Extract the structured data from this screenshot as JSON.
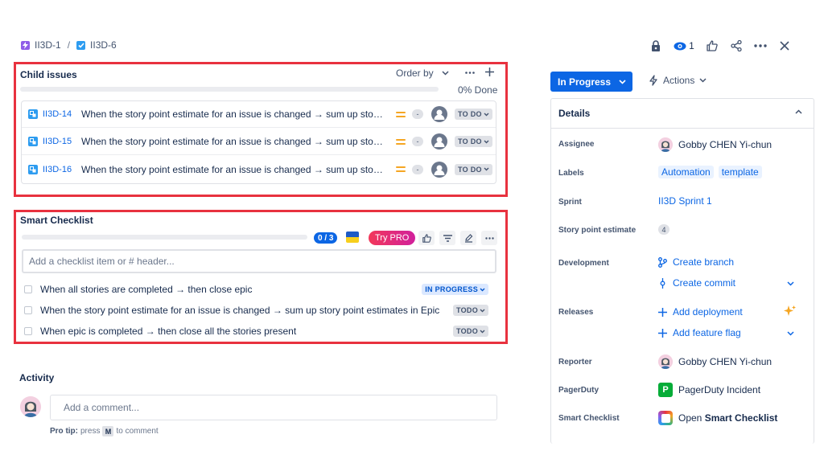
{
  "breadcrumb": {
    "parent_key": "II3D-1",
    "separator": "/",
    "current_key": "II3D-6"
  },
  "toolbar": {
    "watch_count": "1",
    "icons": [
      "lock-icon",
      "eye-icon",
      "thumbs-up-icon",
      "share-icon",
      "more-icon",
      "close-icon"
    ]
  },
  "child_issues": {
    "title": "Child issues",
    "order_by_label": "Order by",
    "progress_label": "0% Done",
    "progress_fraction": 0,
    "items": [
      {
        "key": "II3D-14",
        "summary": "When the story point estimate for an issue is changed → sum up story points estimates in Epic",
        "estimate": "-",
        "status": "TO DO"
      },
      {
        "key": "II3D-15",
        "summary": "When the story point estimate for an issue is changed → sum up story points estimates in Epic",
        "estimate": "-",
        "status": "TO DO"
      },
      {
        "key": "II3D-16",
        "summary": "When the story point estimate for an issue is changed → sum up story points estimates in Epic",
        "estimate": "-",
        "status": "TO DO"
      }
    ]
  },
  "smart_checklist": {
    "title": "Smart Checklist",
    "count": "0 / 3",
    "progress_fraction": 0,
    "try_pro_label": "Try PRO",
    "input_placeholder": "Add a checklist item or # header...",
    "items": [
      {
        "text": "When all stories are completed → then close epic",
        "status": "IN PROGRESS"
      },
      {
        "text": "When the story point estimate for an issue is changed → sum up story point estimates in Epic",
        "status": "TODO"
      },
      {
        "text": "When epic is completed → then close all the stories present",
        "status": "TODO"
      }
    ]
  },
  "activity": {
    "title": "Activity",
    "comment_placeholder": "Add a comment...",
    "pro_tip_label": "Pro tip:",
    "pro_tip_press": "press",
    "pro_tip_key": "M",
    "pro_tip_suffix": "to comment"
  },
  "status_button": {
    "label": "In Progress"
  },
  "actions_button": {
    "label": "Actions"
  },
  "details": {
    "title": "Details",
    "assignee_label": "Assignee",
    "assignee": "Gobby CHEN Yi-chun",
    "labels_label": "Labels",
    "labels": [
      "Automation",
      "template"
    ],
    "sprint_label": "Sprint",
    "sprint": "II3D Sprint 1",
    "story_points_label": "Story point estimate",
    "story_points": "4",
    "development_label": "Development",
    "create_branch": "Create branch",
    "create_commit": "Create commit",
    "releases_label": "Releases",
    "add_deployment": "Add deployment",
    "add_feature_flag": "Add feature flag",
    "reporter_label": "Reporter",
    "reporter": "Gobby CHEN Yi-chun",
    "pagerduty_label": "PagerDuty",
    "pagerduty_value": "PagerDuty Incident",
    "pagerduty_icon_letter": "P",
    "smart_checklist_label": "Smart Checklist",
    "open_prefix": "Open",
    "open_bold": "Smart Checklist"
  },
  "colors": {
    "accent": "#0c66e4",
    "highlight_border": "#e8323f",
    "priority_medium": "#f5a623",
    "pagerduty_green": "#06ac38"
  }
}
